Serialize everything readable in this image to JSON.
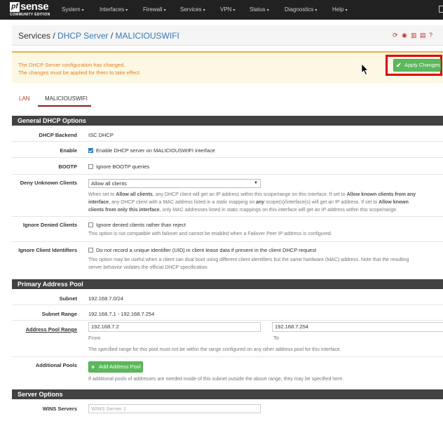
{
  "nav": {
    "logo_word": "sense",
    "logo_mark": "pf",
    "logo_sub": "COMMUNITY EDITION",
    "items": [
      "System",
      "Interfaces",
      "Firewall",
      "Services",
      "VPN",
      "Status",
      "Diagnostics",
      "Help"
    ]
  },
  "breadcrumb": {
    "root": "Services",
    "sep": "/",
    "section": "DHCP Server",
    "page": "MALICIOUSWIFI"
  },
  "alert": {
    "line1": "The DHCP Server configuration has changed.",
    "line2": "The changes must be applied for them to take effect.",
    "apply_label": "Apply Changes"
  },
  "tabs": [
    "LAN",
    "MALICIOUSWIFI"
  ],
  "general": {
    "title": "General DHCP Options",
    "backend_label": "DHCP Backend",
    "backend_value": "ISC DHCP",
    "enable_label": "Enable",
    "enable_text": "Enable DHCP server on MALICIOUSWIFI interface",
    "enable_checked": true,
    "bootp_label": "BOOTP",
    "bootp_text": "Ignore BOOTP queries",
    "deny_label": "Deny Unknown Clients",
    "deny_value": "Allow all clients",
    "deny_help": [
      [
        "When set to ",
        "Allow all clients",
        ", any DHCP client will get an IP address within this scope/range on this interface. If set to ",
        "Allow known clients from any"
      ],
      [
        "interface",
        ", any DHCP client with a MAC address listed in a static mapping on ",
        "any",
        " scope(s)/interface(s) will get an IP address. If set to ",
        "Allow known"
      ],
      [
        "clients from only this interface",
        ", only MAC addresses listed in static mappings on this interface will get an IP address within this scope/range."
      ]
    ],
    "ignore_denied_label": "Ignore Denied Clients",
    "ignore_denied_text": "Ignore denied clients rather than reject",
    "ignore_denied_help": "This option is not compatible with failover and cannot be enabled when a Failover Peer IP address is configured.",
    "ignore_ids_label": "Ignore Client Identifiers",
    "ignore_ids_text": "Do not record a unique identifier (UID) in client lease data if present in the client DHCP request",
    "ignore_ids_help1": "This option may be useful when a client can dual boot using different client identifiers but the same hardware (MAC) address. Note that the resulting",
    "ignore_ids_help2": "server behavior violates the official DHCP specification."
  },
  "pool": {
    "title": "Primary Address Pool",
    "subnet_label": "Subnet",
    "subnet_value": "192.168.7.0/24",
    "range_label": "Subnet Range",
    "range_value": "192.168.7.1 - 192.168.7.254",
    "pool_label": "Address Pool Range",
    "from_value": "192.168.7.2",
    "to_value": "192.168.7.254",
    "from_label": "From",
    "to_label": "To",
    "pool_help": "The specified range for this pool must not be within the range configured on any other address pool for this interface.",
    "additional_label": "Additional Pools",
    "add_button": "Add Address Pool",
    "additional_help": "If additional pools of addresses are needed inside of this subnet outside the above range, they may be specified here."
  },
  "server": {
    "title": "Server Options",
    "wins_label": "WINS Servers",
    "wins_placeholder": "WINS Server 1"
  }
}
